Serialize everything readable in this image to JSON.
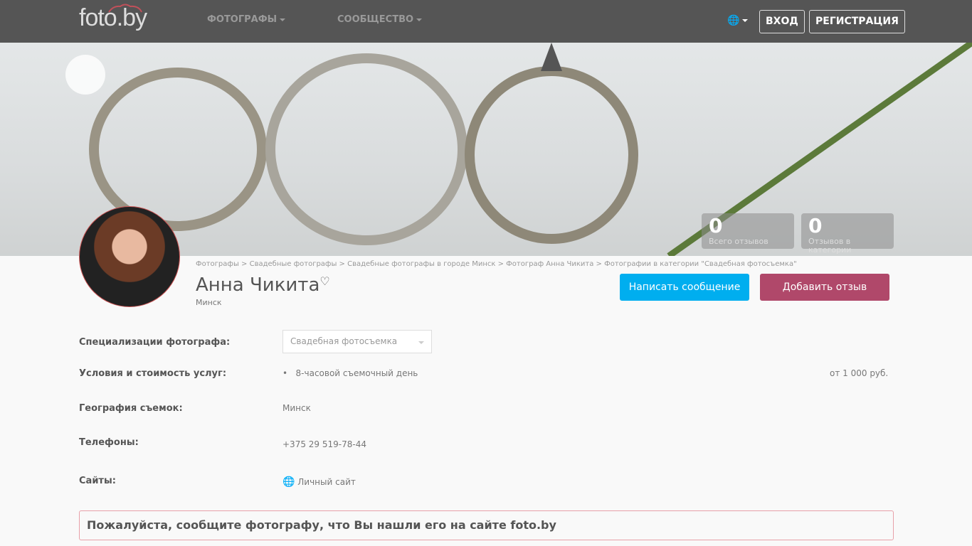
{
  "nav": {
    "logo": "foto.by",
    "photographers": "ФОТОГРАФЫ",
    "community": "СООБЩЕСТВО",
    "login": "ВХОД",
    "register": "РЕГИСТРАЦИЯ"
  },
  "stats": [
    {
      "value": "0",
      "label": "Всего отзывов"
    },
    {
      "value": "0",
      "label": "Отзывов в категории"
    }
  ],
  "breadcrumb": "Фотографы > Свадебные фотографы > Свадебные фотографы в городе Минск > Фотограф Анна Чикита > Фотографии в категории \"Свадебная фотосъемка\"",
  "profile": {
    "name": "Анна Чикита",
    "city": "Минск",
    "message_button": "Написать сообщение",
    "review_button": "Добавить отзыв"
  },
  "details": {
    "spec_label": "Специализации фотографа:",
    "spec_value": "Свадебная фотосъемка",
    "terms_label": "Условия и стоимость услуг:",
    "terms_item": "8-часовой съемочный день",
    "terms_price": "от 1 000 руб.",
    "geo_label": "География съемок:",
    "geo_value": "Минск",
    "phones_label": "Телефоны:",
    "phone": "+375 29 519-78-44",
    "sites_label": "Сайты:",
    "site": "Личный сайт"
  },
  "notice": "Пожалуйста, сообщите фотографу, что Вы нашли его на сайте foto.by"
}
